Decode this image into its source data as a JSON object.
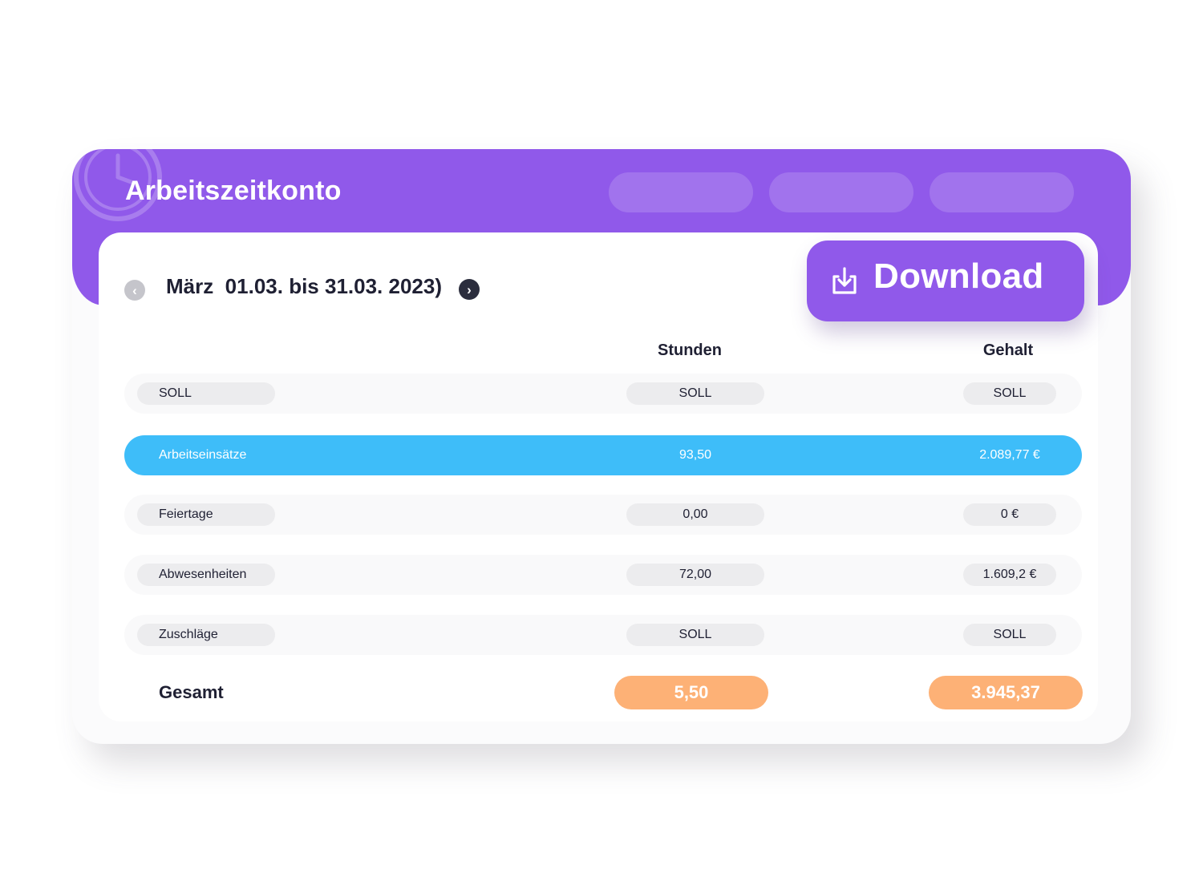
{
  "app": {
    "title": "Arbeitszeitkonto"
  },
  "toolbar": {
    "download_label": "Download"
  },
  "period": {
    "label": "März  01.03. bis 31.03. 2023)"
  },
  "table": {
    "columns": {
      "hours": "Stunden",
      "salary": "Gehalt"
    },
    "rows": [
      {
        "label": "SOLL",
        "hours": "SOLL",
        "salary": "SOLL"
      },
      {
        "label": "Arbeitseinsätze",
        "hours": "93,50",
        "salary": "2.089,77 €"
      },
      {
        "label": "Feiertage",
        "hours": "0,00",
        "salary": "0 €"
      },
      {
        "label": "Abwesenheiten",
        "hours": "72,00",
        "salary": "1.609,2 €"
      },
      {
        "label": "Zuschläge",
        "hours": "SOLL",
        "salary": "SOLL"
      }
    ],
    "total": {
      "label": "Gesamt",
      "hours": "5,50",
      "salary": "3.945,37"
    }
  },
  "colors": {
    "brand": "#9059ea",
    "highlight_row": "#3ebdf9",
    "total_accent": "#fdb176"
  }
}
